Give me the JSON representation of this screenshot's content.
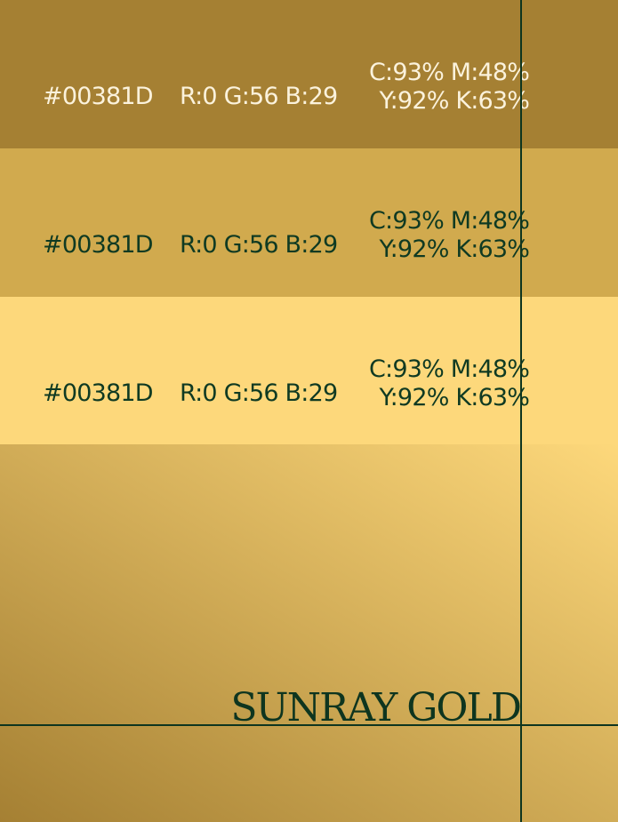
{
  "palette": {
    "title": "SUNRAY GOLD",
    "swatches": [
      {
        "background": "#A58033",
        "text_color": "#FBF2DC",
        "hex": "#00381D",
        "rgb": "R:0 G:56 B:29",
        "cmyk_line1": "C:93% M:48%",
        "cmyk_line2": "Y:92% K:63%"
      },
      {
        "background": "#D1AA4E",
        "text_color": "#0F3A22",
        "hex": "#00381D",
        "rgb": "R:0 G:56 B:29",
        "cmyk_line1": "C:93% M:48%",
        "cmyk_line2": "Y:92% K:63%"
      },
      {
        "background": "#FDD87B",
        "text_color": "#0F3A22",
        "hex": "#00381D",
        "rgb": "R:0 G:56 B:29",
        "cmyk_line1": "C:93% M:48%",
        "cmyk_line2": "Y:92% K:63%"
      }
    ],
    "gradient": {
      "start_color": "#A58033",
      "end_color": "#FDD87B"
    },
    "guide_color": "#0E351F",
    "title_color": "#0E351F"
  }
}
